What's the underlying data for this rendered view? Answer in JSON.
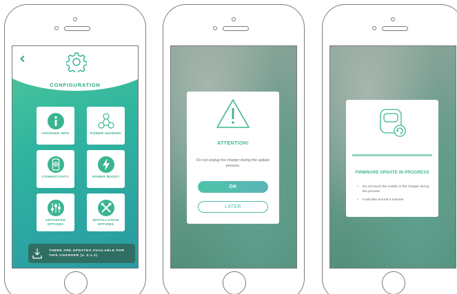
{
  "screens": {
    "configuration": {
      "title": "CONFIGURATION",
      "back_icon": "chevron-left-icon",
      "header_icon": "gear-icon",
      "tiles": [
        {
          "label": "CHARGER INFO",
          "icon": "info-icon"
        },
        {
          "label": "POWER SHARING",
          "icon": "power-sharing-icon"
        },
        {
          "label": "CONNECTIVITY",
          "icon": "phone-globe-icon"
        },
        {
          "label": "POWER BOOST",
          "icon": "lightning-icon"
        },
        {
          "label": "ADVANCED OPTIONS",
          "icon": "sliders-icon"
        },
        {
          "label": "INSTALLATION OPTIONS",
          "icon": "tools-icon"
        }
      ],
      "update_banner": {
        "line1": "THERE ARE UPDATES AVAILABLE FOR",
        "line2": "THIS CHARGER (v. 2.1.1)",
        "icon": "download-icon"
      }
    },
    "attention_dialog": {
      "icon": "warning-icon",
      "title": "ATTENTION!",
      "message": "Do not unplug the charger during the update process.",
      "ok_label": "OK",
      "later_label": "LATER"
    },
    "firmware_dialog": {
      "icon": "charger-icon",
      "progress": 1.0,
      "title": "FIRMWARE UPDATE IN PROGRESS",
      "notes": [
        "Do not touch the mobile or the charger during the process.",
        "It will take around 5 minutes"
      ]
    }
  },
  "colors": {
    "accent": "#3ab58f",
    "gradient_start": "#4cc89a",
    "gradient_end": "#2a9aa3",
    "banner": "#2f6f63"
  }
}
